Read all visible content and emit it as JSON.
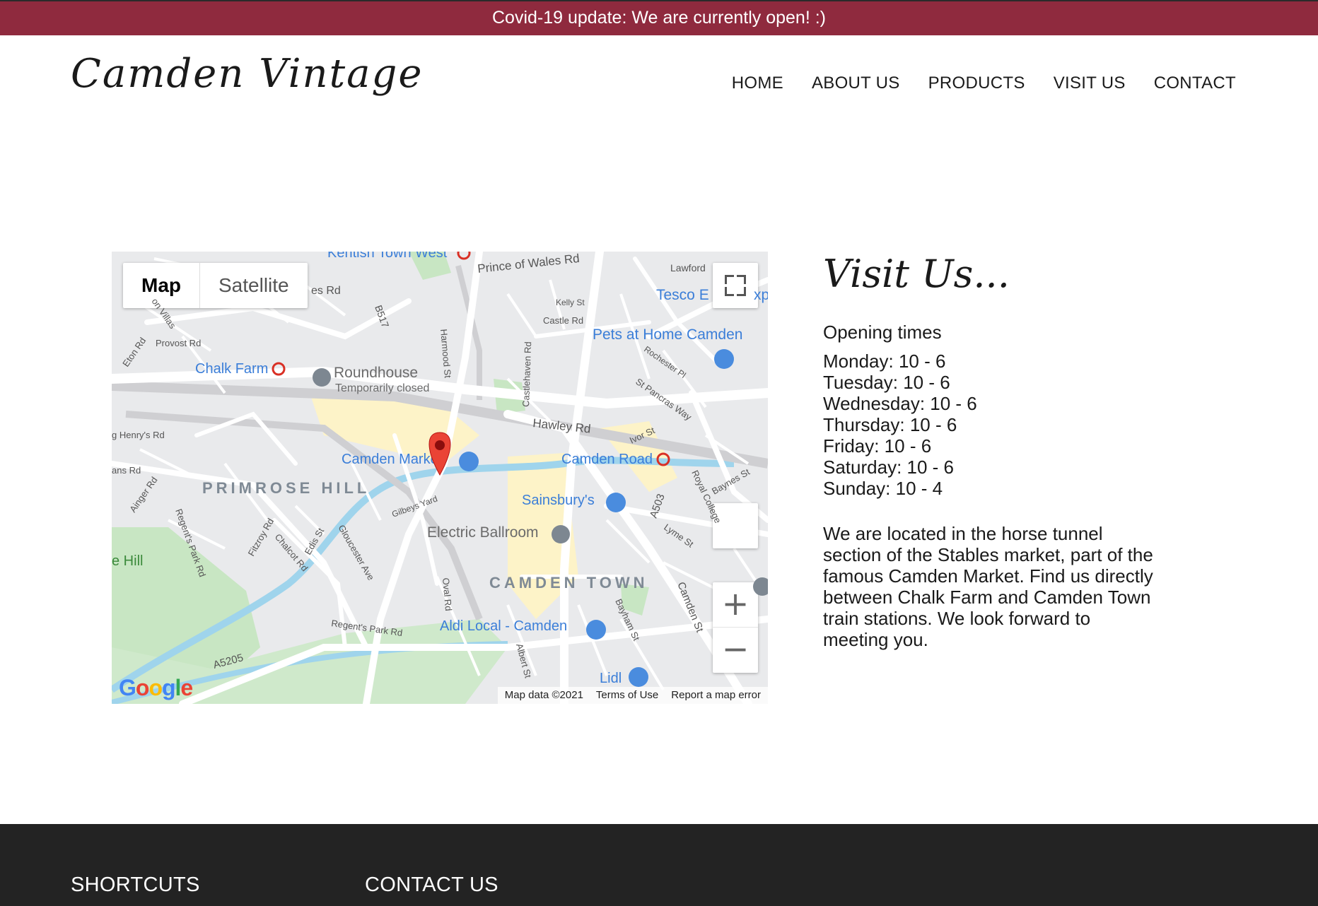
{
  "banner": {
    "text": "Covid-19 update: We are currently open! :)"
  },
  "header": {
    "logo": "Camden Vintage",
    "nav": [
      "HOME",
      "ABOUT US",
      "PRODUCTS",
      "VISIT US",
      "CONTACT"
    ]
  },
  "map": {
    "type_buttons": [
      "Map",
      "Satellite"
    ],
    "labels": {
      "kentish": "Kentish Town West",
      "prince": "Prince of Wales Rd",
      "lawford": "Lawford",
      "tesco": "Tesco E",
      "tesco_tail": "xp",
      "pets": "Pets at Home Camden",
      "chalk_farm": "Chalk Farm",
      "roundhouse": "Roundhouse",
      "roundhouse_status": "Temporarily closed",
      "hawley": "Hawley Rd",
      "camden_market": "Camden Market",
      "camden_road": "Camden Road",
      "primrose": "PRIMROSE HILL",
      "sainsburys": "Sainsbury's",
      "ballroom": "Electric Ballroom",
      "camden_town": "CAMDEN TOWN",
      "aldi": "Aldi Local - Camden",
      "lidl": "Lidl",
      "a5205": "A5205",
      "a503": "A503",
      "hill": "e Hill",
      "provost": "Provost Rd",
      "eton": "Eton Rd",
      "b517": "B517",
      "harmood": "Harmood St",
      "castlehaven": "Castlehaven Rd",
      "kelly": "Kelly St",
      "castle": "Castle Rd",
      "rochester": "Rochester Pl",
      "stpancras": "St Pancras Way",
      "ivor": "Ivor St",
      "gilbeys": "Gilbeys Yard",
      "fitzroy": "Fitzroy Rd",
      "chalcot": "Chalcot Rd",
      "edis": "Edis St",
      "gloucester": "Gloucester Ave",
      "regents_park_rd": "Regent's Park Rd",
      "oval": "Oval Rd",
      "albert": "Albert St",
      "bayham": "Bayham St",
      "camden_st": "Camden St",
      "royal_college": "Royal College",
      "lyme": "Lyme St",
      "baynes": "Baynes St",
      "ainger": "Ainger Rd",
      "henrys": "g Henry's Rd",
      "ans": "ans Rd",
      "villas": "on Villas",
      "es_rd": "es Rd",
      "regents_park_rd2": "Regent's Park Rd"
    },
    "attribution": [
      "Map data ©2021",
      "Terms of Use",
      "Report a map error"
    ],
    "google": [
      "G",
      "o",
      "o",
      "g",
      "l",
      "e"
    ],
    "google_colors": [
      "#4285F4",
      "#EA4335",
      "#FBBC05",
      "#4285F4",
      "#34A853",
      "#EA4335"
    ],
    "icons": [
      "fullscreen-icon",
      "pegman-icon",
      "zoom-in-icon",
      "zoom-out-icon",
      "location-pin-icon",
      "shopping-cart-icon"
    ],
    "zoom_in": "+",
    "zoom_out": "−"
  },
  "visit": {
    "title": "Visit Us...",
    "opening_heading": "Opening times",
    "hours": [
      "Monday: 10 - 6",
      "Tuesday: 10 - 6",
      "Wednesday: 10 - 6",
      "Thursday: 10 - 6",
      "Friday: 10 - 6",
      "Saturday: 10 - 6",
      "Sunday: 10 - 4"
    ],
    "description": "We are located in the horse tunnel section of the Stables market, part of the famous Camden Market. Find us directly between Chalk Farm and Camden Town train stations. We look forward to meeting you."
  },
  "footer": {
    "shortcuts": "SHORTCUTS",
    "contact": "CONTACT US"
  },
  "colors": {
    "banner": "#8f2a3e",
    "footer": "#232323",
    "map_road": "#ffffff",
    "map_highlight": "#fdf3c8",
    "map_park": "#c8e6c3",
    "map_water": "#9fd4ec",
    "poi_blue": "#4a8cde"
  }
}
